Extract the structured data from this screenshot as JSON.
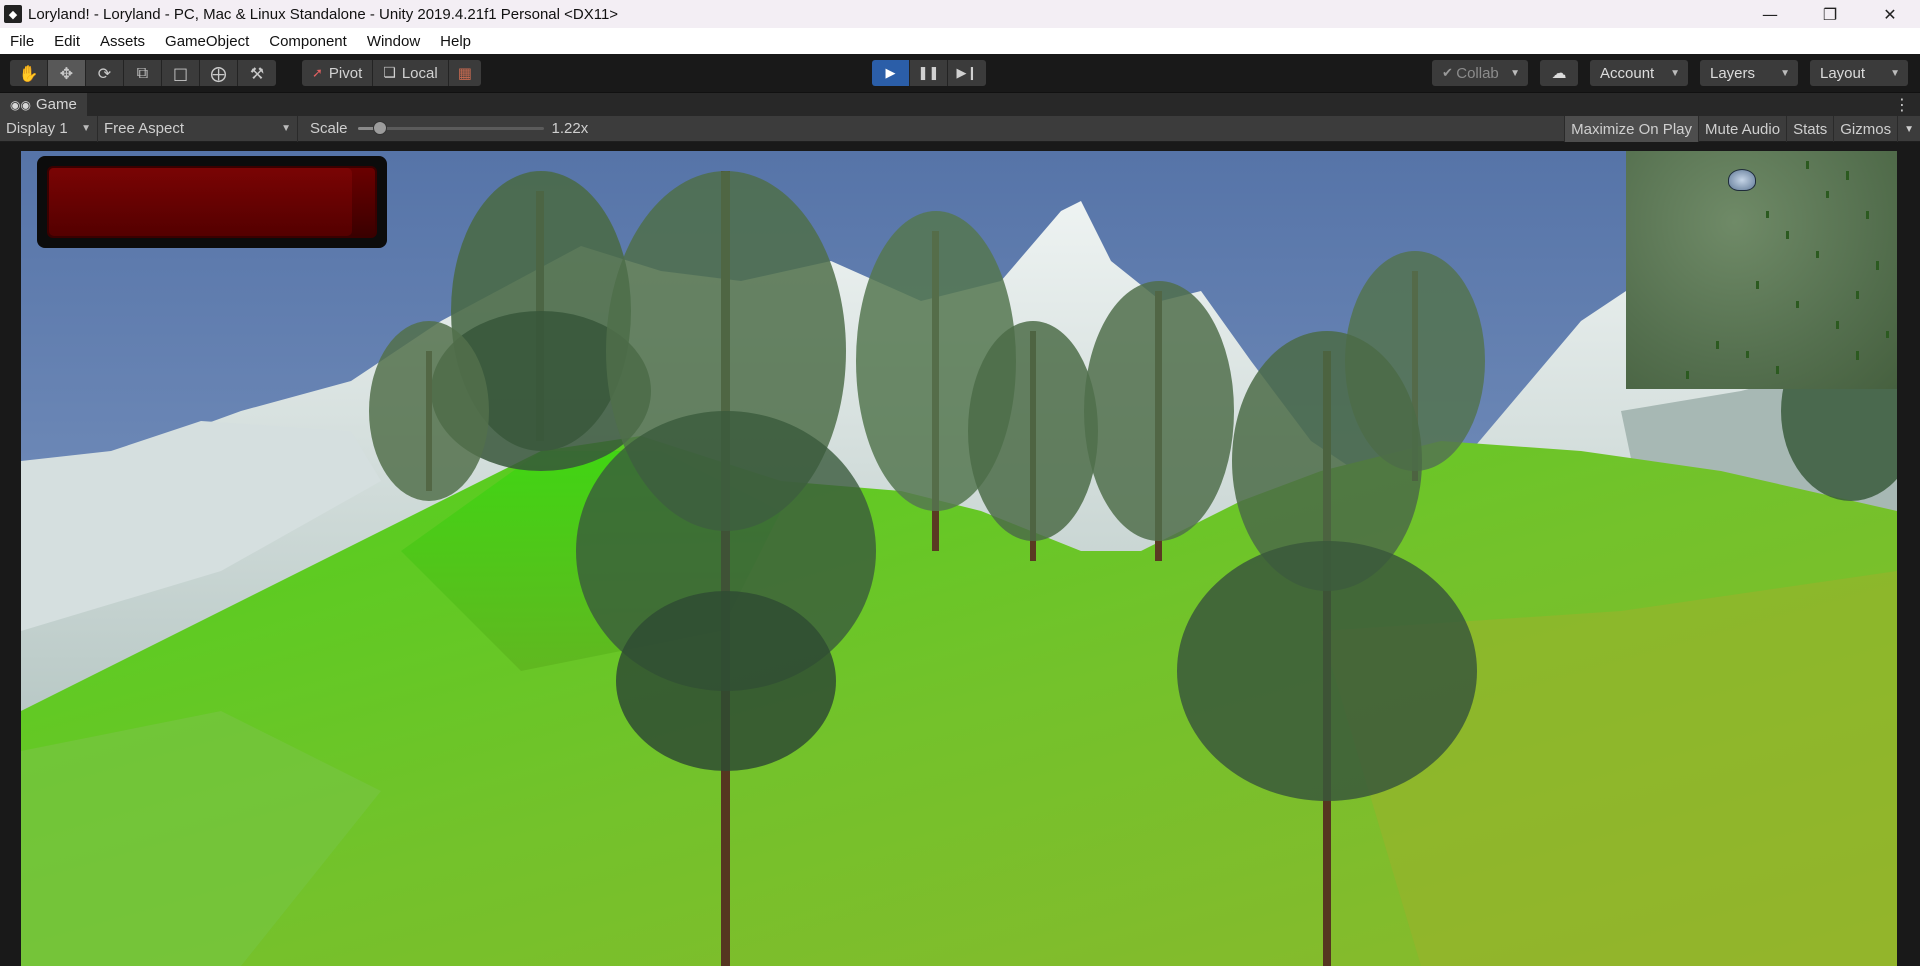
{
  "window": {
    "title": "Loryland! - Loryland - PC, Mac & Linux Standalone - Unity 2019.4.21f1 Personal <DX11>",
    "app_icon": "unity-icon",
    "controls": [
      "minimize-icon",
      "restore-icon",
      "close-icon"
    ]
  },
  "menu": {
    "items": [
      "File",
      "Edit",
      "Assets",
      "GameObject",
      "Component",
      "Window",
      "Help"
    ]
  },
  "toolbar": {
    "transform_tools": [
      "hand-tool-icon",
      "move-tool-icon",
      "rotate-tool-icon",
      "scale-tool-icon",
      "rect-tool-icon",
      "transform-tool-icon",
      "custom-tool-icon"
    ],
    "active_tool": "move-tool-icon",
    "pivot_label": "Pivot",
    "local_label": "Local",
    "play_state": "playing",
    "collab_label": "Collab",
    "account_label": "Account",
    "layers_label": "Layers",
    "layout_label": "Layout"
  },
  "game_tab": {
    "label": "Game"
  },
  "game_bar": {
    "display_label": "Display 1",
    "aspect_label": "Free Aspect",
    "scale_label": "Scale",
    "scale_value": "1.22x",
    "scale_fraction": 0.12,
    "maximize_label": "Maximize On Play",
    "mute_label": "Mute Audio",
    "stats_label": "Stats",
    "gizmos_label": "Gizmos",
    "maximize_on": true
  },
  "hud": {
    "health_fraction": 0.93,
    "health_color": "#6a0000"
  },
  "colors": {
    "play_active": "#2b5ea8",
    "sky_top": "#5674a8",
    "grass": "#55c51a"
  }
}
